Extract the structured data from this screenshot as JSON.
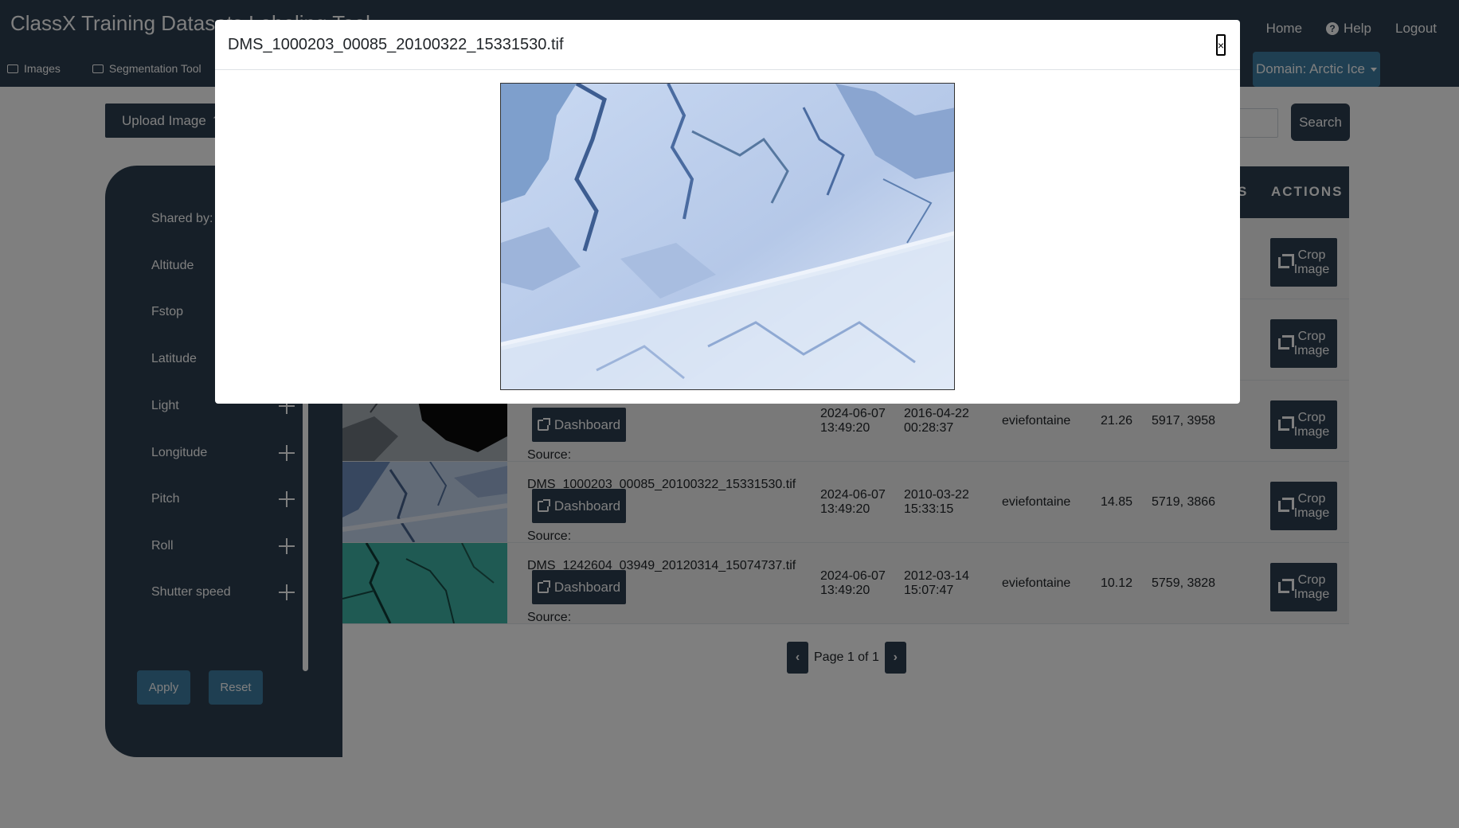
{
  "app": {
    "title": "ClassX Training Datasets Labeling Tool"
  },
  "topnav": {
    "home": "Home",
    "help": "Help",
    "logout": "Logout"
  },
  "subnav": {
    "images": "Images",
    "segmentation": "Segmentation Tool"
  },
  "domain": {
    "label": "Domain: Arctic Ice"
  },
  "toolbar": {
    "upload": "Upload Image",
    "search": "Search",
    "search_value": ""
  },
  "sidebar": {
    "filters": [
      {
        "label": "Shared by:"
      },
      {
        "label": "Altitude"
      },
      {
        "label": "Fstop"
      },
      {
        "label": "Latitude"
      },
      {
        "label": "Light"
      },
      {
        "label": "Longitude"
      },
      {
        "label": "Pitch"
      },
      {
        "label": "Roll"
      },
      {
        "label": "Shutter speed"
      }
    ],
    "apply": "Apply",
    "reset": "Reset"
  },
  "table": {
    "header_partial": "S",
    "actions": "ACTIONS",
    "rows": [
      {
        "filename": "",
        "uploaded_date": "",
        "uploaded_time": "",
        "captured_date": "",
        "captured_time": "",
        "user": "",
        "value": "",
        "dims": "",
        "thumb": "hidden"
      },
      {
        "filename": "",
        "uploaded_date": "",
        "uploaded_time": "",
        "captured_date": "",
        "captured_time": "",
        "user": "",
        "value": "",
        "dims": "",
        "thumb": "hidden"
      },
      {
        "filename": "",
        "uploaded_date": "2024-06-07",
        "uploaded_time": "13:49:20",
        "captured_date": "2016-04-22",
        "captured_time": "00:28:37",
        "user": "eviefontaine",
        "value": "21.26",
        "dims": "5917, 3958",
        "thumb": "dark-ice"
      },
      {
        "filename": "DMS_1000203_00085_20100322_15331530.tif",
        "uploaded_date": "2024-06-07",
        "uploaded_time": "13:49:20",
        "captured_date": "2010-03-22",
        "captured_time": "15:33:15",
        "user": "eviefontaine",
        "value": "14.85",
        "dims": "5719, 3866",
        "thumb": "blue-ice"
      },
      {
        "filename": "DMS_1242604_03949_20120314_15074737.tif",
        "uploaded_date": "2024-06-07",
        "uploaded_time": "13:49:20",
        "captured_date": "2012-03-14",
        "captured_time": "15:07:47",
        "user": "eviefontaine",
        "value": "10.12",
        "dims": "5759, 3828",
        "thumb": "teal-ice"
      }
    ],
    "dashboard_label": "Dashboard",
    "source_label": "Source:",
    "crop_line1": "Crop",
    "crop_line2": "Image"
  },
  "pagination": {
    "text": "Page 1 of 1",
    "prev_icon": "chevron-left-icon",
    "next_icon": "chevron-right-icon"
  },
  "modal": {
    "title": "DMS_1000203_00085_20100322_15331530.tif",
    "close": "×"
  },
  "colors": {
    "navy": "#2c3e50",
    "steel_blue": "#3f7fa4",
    "backdrop": "rgba(0,0,0,0.5)"
  }
}
